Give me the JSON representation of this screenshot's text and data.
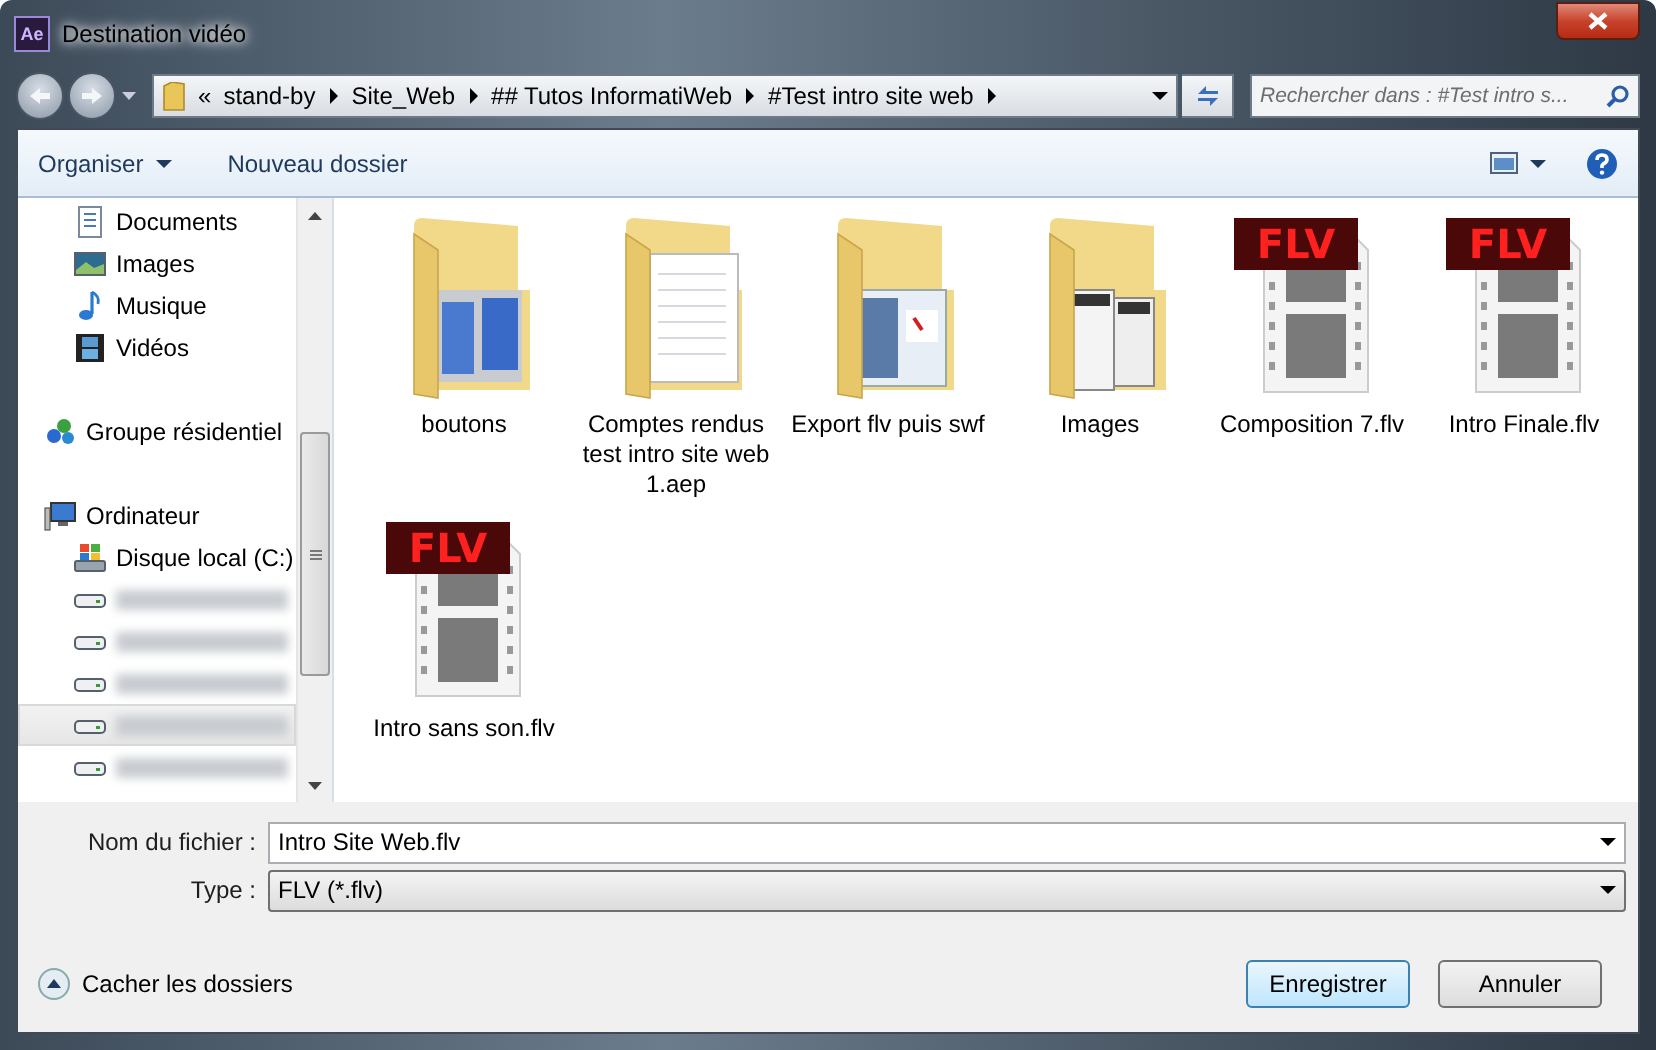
{
  "window": {
    "app_icon": "Ae",
    "title": "Destination vidéo"
  },
  "address": {
    "overflow": "«",
    "segments": [
      "stand-by",
      "Site_Web",
      "## Tutos InformatiWeb",
      "#Test intro site web"
    ]
  },
  "search": {
    "placeholder": "Rechercher dans : #Test intro s..."
  },
  "toolbar": {
    "organize": "Organiser",
    "new_folder": "Nouveau dossier"
  },
  "sidebar": {
    "items": [
      {
        "kind": "documents",
        "label": "Documents",
        "selected": false
      },
      {
        "kind": "images",
        "label": "Images",
        "selected": false
      },
      {
        "kind": "music",
        "label": "Musique",
        "selected": false
      },
      {
        "kind": "videos",
        "label": "Vidéos",
        "selected": false
      },
      {
        "kind": "homegroup",
        "label": "Groupe résidentiel",
        "selected": false
      },
      {
        "kind": "computer",
        "label": "Ordinateur",
        "selected": false,
        "children": [
          {
            "kind": "disk",
            "label": "Disque local (C:)",
            "selected": false
          },
          {
            "kind": "drive",
            "blurred": true,
            "selected": false
          },
          {
            "kind": "drive",
            "blurred": true,
            "selected": false
          },
          {
            "kind": "drive",
            "blurred": true,
            "selected": false
          },
          {
            "kind": "drive",
            "blurred": true,
            "selected": true
          },
          {
            "kind": "drive",
            "blurred": true,
            "selected": false
          }
        ]
      }
    ]
  },
  "files": [
    {
      "kind": "folder",
      "name": "boutons"
    },
    {
      "kind": "folder",
      "name": "Comptes rendus test intro site web 1.aep"
    },
    {
      "kind": "folder",
      "name": "Export flv puis swf"
    },
    {
      "kind": "folder",
      "name": "Images"
    },
    {
      "kind": "flv",
      "badge": "FLV",
      "name": "Composition 7.flv"
    },
    {
      "kind": "flv",
      "badge": "FLV",
      "name": "Intro Finale.flv"
    },
    {
      "kind": "flv",
      "badge": "FLV",
      "name": "Intro sans son.flv"
    }
  ],
  "form": {
    "filename_label": "Nom du fichier :",
    "filename": "Intro Site Web.flv",
    "type_label": "Type :",
    "type": "FLV (*.flv)"
  },
  "footer": {
    "hide_folders": "Cacher les dossiers",
    "save": "Enregistrer",
    "cancel": "Annuler"
  }
}
